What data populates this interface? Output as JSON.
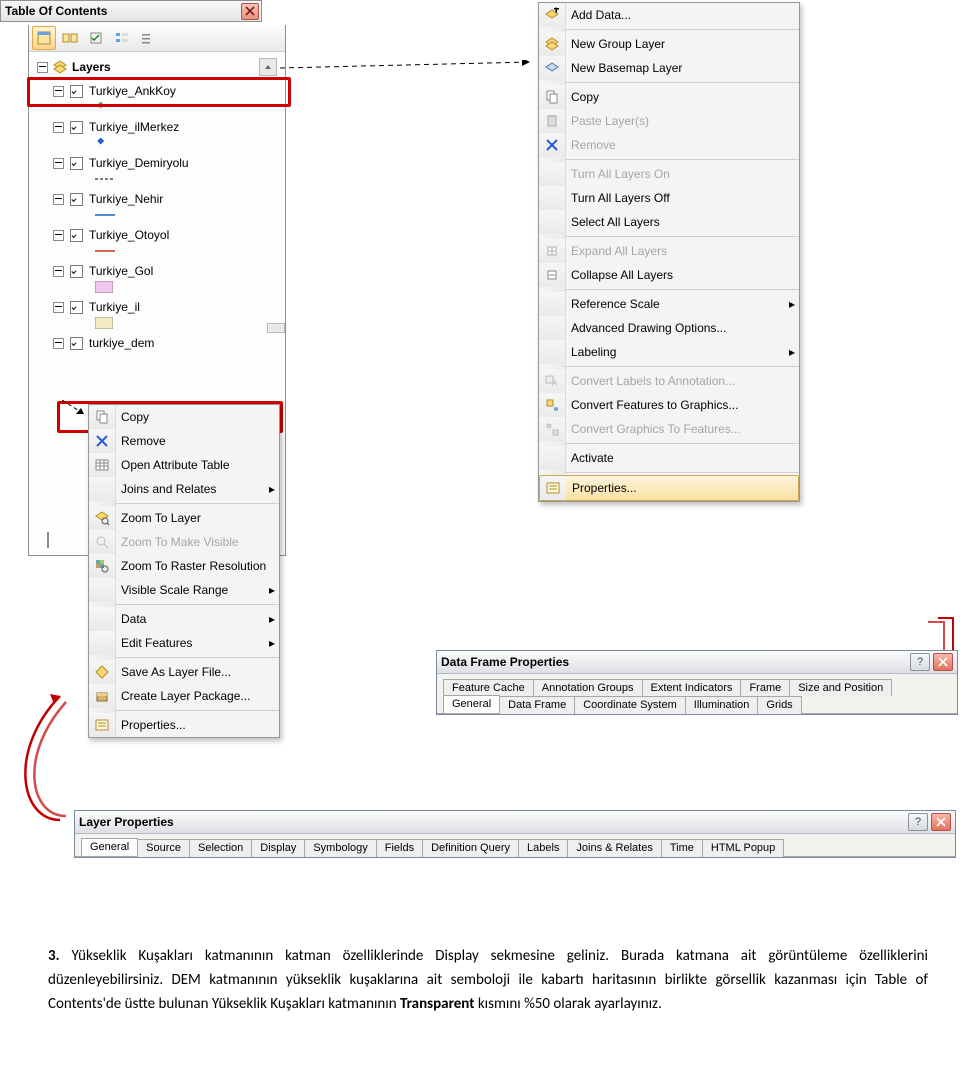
{
  "toc": {
    "title": "Table Of Contents",
    "layers_root": "Layers",
    "items": [
      {
        "name": "Turkiye_AnkKoy",
        "sym": "green-diamond"
      },
      {
        "name": "Turkiye_ilMerkez",
        "sym": "blue-diamond"
      },
      {
        "name": "Turkiye_Demiryolu",
        "sym": "line-dash"
      },
      {
        "name": "Turkiye_Nehir",
        "sym": "line-blue"
      },
      {
        "name": "Turkiye_Otoyol",
        "sym": "line-red"
      },
      {
        "name": "Turkiye_Gol",
        "sym": "box-pink"
      },
      {
        "name": "Turkiye_il",
        "sym": "box-beige"
      },
      {
        "name": "turkiye_dem",
        "sym": ""
      }
    ]
  },
  "layer_ctx": {
    "items": [
      {
        "icon": "copy-icon",
        "label": "Copy",
        "disabled": false
      },
      {
        "icon": "remove-x-icon",
        "label": "Remove",
        "disabled": false
      },
      {
        "icon": "table-icon",
        "label": "Open Attribute Table",
        "disabled": false
      },
      {
        "icon": "",
        "label": "Joins and Relates",
        "arrow": true
      },
      {
        "sep": true
      },
      {
        "icon": "zoom-layer-icon",
        "label": "Zoom To Layer"
      },
      {
        "icon": "zoom-visible-icon",
        "label": "Zoom To Make Visible",
        "disabled": true
      },
      {
        "icon": "zoom-raster-icon",
        "label": "Zoom To Raster Resolution"
      },
      {
        "icon": "",
        "label": "Visible Scale Range",
        "arrow": true
      },
      {
        "sep": true
      },
      {
        "icon": "",
        "label": "Data",
        "arrow": true
      },
      {
        "icon": "",
        "label": "Edit Features",
        "arrow": true
      },
      {
        "sep": true
      },
      {
        "icon": "save-diamond-icon",
        "label": "Save As Layer File..."
      },
      {
        "icon": "package-icon",
        "label": "Create Layer Package..."
      },
      {
        "sep": true
      },
      {
        "icon": "properties-icon",
        "label": "Properties..."
      }
    ]
  },
  "frame_ctx": {
    "items": [
      {
        "icon": "add-data-icon",
        "label": "Add Data..."
      },
      {
        "sep": true
      },
      {
        "icon": "new-group-icon",
        "label": "New Group Layer"
      },
      {
        "icon": "basemap-icon",
        "label": "New Basemap Layer"
      },
      {
        "sep": true
      },
      {
        "icon": "copy-icon",
        "label": "Copy"
      },
      {
        "icon": "paste-icon",
        "label": "Paste Layer(s)",
        "disabled": true
      },
      {
        "icon": "remove-x-icon",
        "label": "Remove",
        "disabled": true
      },
      {
        "sep": true
      },
      {
        "icon": "",
        "label": "Turn All Layers On",
        "disabled": true
      },
      {
        "icon": "",
        "label": "Turn All Layers Off"
      },
      {
        "icon": "",
        "label": "Select All Layers"
      },
      {
        "sep": true
      },
      {
        "icon": "plus-box-icon",
        "label": "Expand All Layers",
        "disabled": true
      },
      {
        "icon": "minus-box-icon",
        "label": "Collapse All Layers"
      },
      {
        "sep": true
      },
      {
        "icon": "",
        "label": "Reference Scale",
        "arrow": true
      },
      {
        "icon": "",
        "label": "Advanced Drawing Options..."
      },
      {
        "icon": "",
        "label": "Labeling",
        "arrow": true
      },
      {
        "sep": true
      },
      {
        "icon": "convert-anno-icon",
        "label": "Convert Labels to Annotation...",
        "disabled": true
      },
      {
        "icon": "convert-feat-icon",
        "label": "Convert Features to Graphics..."
      },
      {
        "icon": "convert-graph-icon",
        "label": "Convert Graphics To Features...",
        "disabled": true
      },
      {
        "sep": true
      },
      {
        "icon": "",
        "label": "Activate"
      },
      {
        "sep": true
      },
      {
        "icon": "properties-icon",
        "label": "Properties...",
        "highlight": true
      }
    ]
  },
  "data_frame_dialog": {
    "title": "Data Frame Properties",
    "tabs_row1": [
      "Feature Cache",
      "Annotation Groups",
      "Extent Indicators",
      "Frame",
      "Size and Position"
    ],
    "tabs_row2": [
      "General",
      "Data Frame",
      "Coordinate System",
      "Illumination",
      "Grids"
    ],
    "active_tab": "General"
  },
  "layer_props_dialog": {
    "title": "Layer Properties",
    "tabs": [
      "General",
      "Source",
      "Selection",
      "Display",
      "Symbology",
      "Fields",
      "Definition Query",
      "Labels",
      "Joins & Relates",
      "Time",
      "HTML Popup"
    ],
    "active_tab": "General"
  },
  "annotation": {
    "num": "3.",
    "text1": "Yükseklik Kuşakları katmanının katman özelliklerinde Display sekmesine geliniz. Burada katmana ait görüntüleme özelliklerini düzenleyebilirsiniz. DEM katmanının yükseklik kuşaklarına ait semboloji ile kabartı haritasının birlikte görsellik kazanması için Table of Contents'de üstte bulunan Yükseklik Kuşakları katmanının ",
    "bold": "Transparent",
    "text2": " kısmını %50 olarak ayarlayınız."
  }
}
